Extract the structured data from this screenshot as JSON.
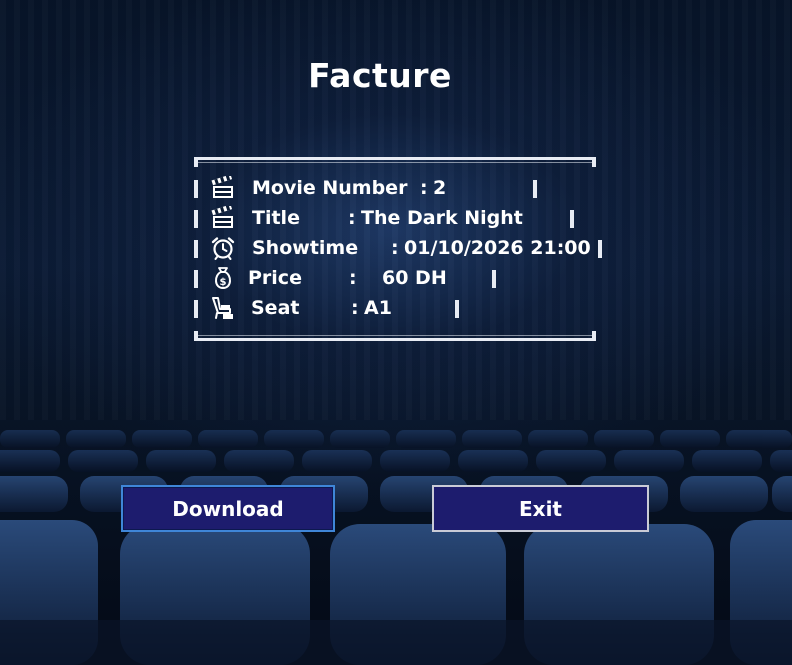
{
  "page": {
    "title": "Facture"
  },
  "invoice": {
    "rows": [
      {
        "icon": "clapperboard-icon",
        "label": "Movie Number",
        "sep": ":",
        "value": "2"
      },
      {
        "icon": "clapperboard-icon",
        "label": "Title",
        "sep": ":",
        "value": "The Dark Night"
      },
      {
        "icon": "alarm-clock-icon",
        "label": "Showtime",
        "sep": ":",
        "value": "01/10/2026 21:00"
      },
      {
        "icon": "money-bag-icon",
        "label": "Price",
        "sep": ":",
        "value": "60 DH"
      },
      {
        "icon": "seat-icon",
        "label": "Seat",
        "sep": ":",
        "value": "A1"
      }
    ]
  },
  "buttons": {
    "download_label": "Download",
    "exit_label": "Exit"
  },
  "colors": {
    "background": "#071428",
    "button_fill": "#1d1c6e",
    "download_border": "#3f86d8",
    "exit_border": "#c9cbd6",
    "text": "#ffffff"
  }
}
